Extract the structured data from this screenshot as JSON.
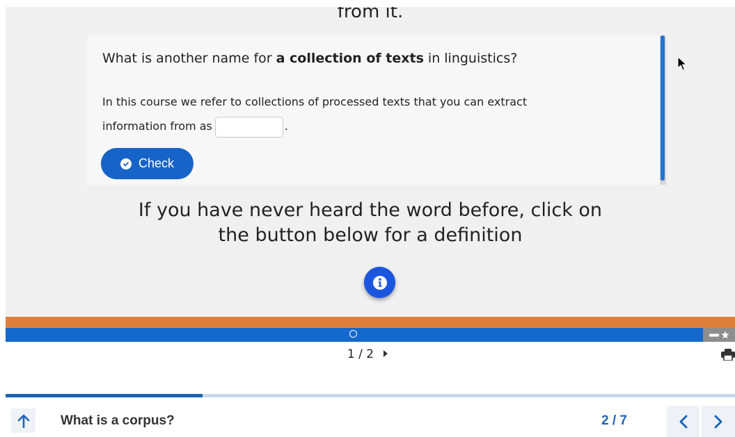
{
  "slide": {
    "heading_fragment": "from it.",
    "quiz": {
      "question_prefix": "What is another name for ",
      "question_bold": "a collection of texts",
      "question_suffix": " in linguistics?",
      "sentence_prefix": "In this course we refer to collections of processed texts that you can extract information from as",
      "sentence_suffix": ".",
      "blank_value": "",
      "check_label": "Check"
    },
    "hint_line1": "If you have never heard the word before, click on",
    "hint_line2": "the button below for a definition",
    "info_icon": "info-icon"
  },
  "player": {
    "page_indicator": "1 / 2",
    "progress_dots": 1,
    "print_icon": "printer-icon"
  },
  "course": {
    "progress_fraction": 0.27,
    "title": "What is a corpus?",
    "page_counter": "2 / 7"
  },
  "colors": {
    "accent_blue": "#1764c9",
    "orange_band": "#e07f3a",
    "player_bar": "#1669cc",
    "counter_blue": "#1c63b7"
  }
}
